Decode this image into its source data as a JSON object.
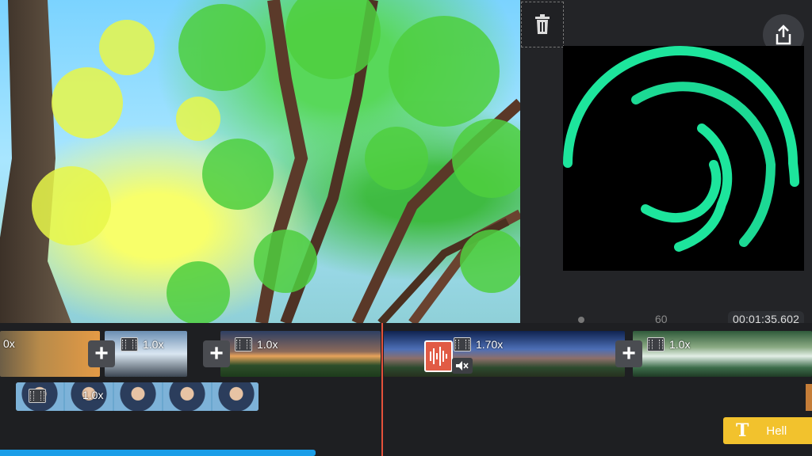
{
  "preview": {
    "description_icon": "image-preview"
  },
  "toolbar": {
    "trash_icon": "trash-icon",
    "share_icon": "share-icon"
  },
  "ruler": {
    "mark": "60",
    "timecode": "00:01:35.602"
  },
  "timeline": {
    "clips": [
      {
        "speed": "0x"
      },
      {
        "speed": "1.0x"
      },
      {
        "speed": "1.0x"
      },
      {
        "speed": "1.70x"
      },
      {
        "speed": "1.0x"
      }
    ],
    "selfie_track": {
      "speed": "1.0x"
    },
    "text_track": {
      "icon": "T",
      "label": "Hell"
    }
  },
  "colors": {
    "playhead": "#e4513a",
    "accent_green": "#1de59c",
    "text_track": "#f2c22d",
    "progress": "#1a9ee8"
  }
}
